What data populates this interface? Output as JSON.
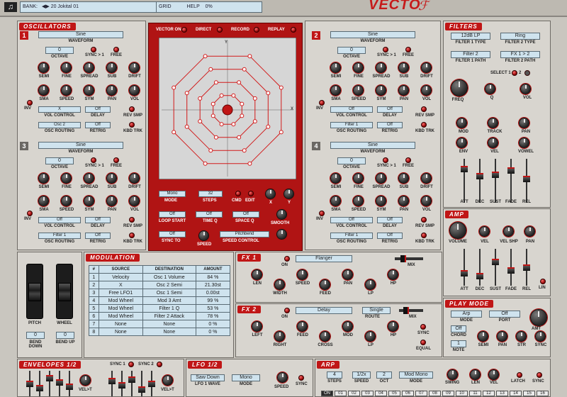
{
  "header": {
    "bank_label": "BANK:",
    "patch": "20 Jokital 01",
    "grid_label": "GRID",
    "help_label": "HELP",
    "percent": "0%",
    "logo": "VECTO"
  },
  "oscillators": {
    "title": "OSCILLATORS",
    "waveform_label": "WAVEFORM",
    "octave_label": "OCTAVE",
    "sync_label": "SYNC > 1",
    "free_label": "FREE",
    "knobs_row1": [
      "SEMI",
      "FINE",
      "SPREAD",
      "SUB",
      "DRIFT"
    ],
    "knobs_row2": [
      "SMA",
      "SPEED",
      "SYM",
      "PAN",
      "VOL"
    ],
    "inv_label": "INV",
    "vol_control_label": "VOL CONTROL",
    "delay_label": "DELAY",
    "rev_smp_label": "REV SMP",
    "osc_routing_label": "OSC ROUTING",
    "retrig_label": "RETRIG",
    "kbd_trk_label": "KBD TRK",
    "units": [
      {
        "num": "1",
        "wave": "Sine",
        "octave": "0",
        "vol_ctrl": "X",
        "delay": "Off",
        "routing": "Osc 2",
        "retrig": "Off"
      },
      {
        "num": "2",
        "wave": "Sine",
        "octave": "0",
        "vol_ctrl": "Off",
        "delay": "Off",
        "routing": "Filter 1",
        "retrig": "Off"
      },
      {
        "num": "3",
        "wave": "Sine",
        "octave": "0",
        "vol_ctrl": "Off",
        "delay": "Off",
        "routing": "Filter 1",
        "retrig": "Off"
      },
      {
        "num": "4",
        "wave": "Sine",
        "octave": "0",
        "vol_ctrl": "Off",
        "delay": "Off",
        "routing": "Filter 1",
        "retrig": "Off"
      }
    ]
  },
  "vector": {
    "vector_on": "VECTOR ON",
    "direct": "DIRECT",
    "record": "RECORD",
    "replay": "REPLAY",
    "axis_x": "X",
    "axis_y": "Y",
    "mode_val": "Mono",
    "mode_label": "MODE",
    "steps_val": "32",
    "steps_label": "STEPS",
    "cmd": "CMD",
    "edit": "EDIT",
    "x_label": "X",
    "y_label": "Y",
    "loop_start_val": "Off",
    "loop_start_label": "LOOP START",
    "time_q_val": "Off",
    "time_q_label": "TIME Q",
    "space_q_val": "Off",
    "space_q_label": "SPACE Q",
    "smooth_label": "SMOOTH",
    "sync_to_val": "Off",
    "sync_to_label": "SYNC TO",
    "speed_label": "SPEED",
    "speed_ctrl_val": "Pitchbend",
    "speed_ctrl_label": "SPEED CONTROL"
  },
  "filters": {
    "title": "FILTERS",
    "f1type": "12dB LP",
    "f1type_label": "FILTER 1 TYPE",
    "f2type": "Ring",
    "f2type_label": "FILTER 2 TYPE",
    "f1path": "Filter 2",
    "f1path_label": "FILTER 1 PATH",
    "f2path": "FX 1 > 2",
    "f2path_label": "FILTER 2 PATH",
    "select_label": "SELECT 1",
    "select_2": "2",
    "knob_labels": [
      "FREQ",
      "Q",
      "VOL",
      "MOD",
      "TRACK",
      "PAN",
      "ENV",
      "VEL",
      "VOWEL"
    ],
    "adsr": [
      "ATT",
      "DEC",
      "SUST",
      "FADE",
      "REL"
    ]
  },
  "amp": {
    "title": "AMP",
    "knob_labels": [
      "VOLUME",
      "VEL",
      "VEL SHP",
      "PAN"
    ],
    "adsr": [
      "ATT",
      "DEC",
      "SUST",
      "FADE",
      "REL"
    ],
    "lin": "LIN"
  },
  "playmode": {
    "title": "PLAY MODE",
    "mode_val": "Arp",
    "mode_label": "MODE",
    "port_val": "Off",
    "port_label": "PORT",
    "amt_label": "AMT",
    "chord_val": "Off",
    "chord_label": "CHORD",
    "note_val": "1",
    "note_label": "NOTE",
    "knobs": [
      "SEMI",
      "PAN",
      "STR",
      "SYNC"
    ]
  },
  "wheels": {
    "pitch": "PITCH",
    "wheel": "WHEEL",
    "bend_down_val": "0",
    "bend_down_label": "BEND DOWN",
    "bend_up_val": "0",
    "bend_up_label": "BEND UP"
  },
  "modulation": {
    "title": "MODULATION",
    "headers": [
      "#",
      "SOURCE",
      "DESTINATION",
      "AMOUNT"
    ],
    "rows": [
      [
        "1",
        "Velocity",
        "Osc 1 Volume",
        "84 %"
      ],
      [
        "2",
        "X",
        "Osc 2 Semi",
        "21.30st"
      ],
      [
        "3",
        "Free LFO1",
        "Osc 1 Semi",
        "0.00st"
      ],
      [
        "4",
        "Mod Wheel",
        "Mod 3 Amt",
        "99 %"
      ],
      [
        "5",
        "Mod Wheel",
        "Filter 1 Q",
        "53 %"
      ],
      [
        "6",
        "Mod Wheel",
        "Filter 2 Attack",
        "78 %"
      ],
      [
        "7",
        "None",
        "None",
        "0 %"
      ],
      [
        "8",
        "None",
        "None",
        "0 %"
      ]
    ]
  },
  "fx1": {
    "title": "FX 1",
    "on": "ON",
    "type": "Flanger",
    "mix": "MIX",
    "knobs": [
      "LEN",
      "WIDTH",
      "SPEED",
      "FEED",
      "PAN",
      "LP",
      "HP"
    ]
  },
  "fx2": {
    "title": "FX 2",
    "on": "ON",
    "type": "Delay",
    "route_val": "Single",
    "route_label": "ROUTE",
    "mix": "MIX",
    "sync": "SYNC",
    "equal": "EQUAL",
    "knobs": [
      "LEFT",
      "RIGHT",
      "FEED",
      "CROSS",
      "MOD",
      "LP",
      "HP"
    ]
  },
  "envelopes": {
    "title": "ENVELOPES 1/2",
    "sync1": "SYNC 1",
    "sync2": "SYNC 2",
    "vel1": "VEL>T",
    "vel2": "VEL>T"
  },
  "lfo": {
    "title": "LFO 1/2",
    "wave_val": "Saw Down",
    "wave_label": "LFO 1 WAVE",
    "mode_val": "Mono",
    "mode_label": "MODE",
    "speed": "SPEED",
    "sync": "SYNC"
  },
  "arp": {
    "title": "ARP",
    "steps_val": "4",
    "steps_label": "STEPS",
    "speed_val": "1/2x",
    "speed_label": "SPEED",
    "oct_val": "2",
    "oct_label": "OCT",
    "mode_val": "Mod Mono",
    "mode_label": "MODE",
    "swing": "SWING",
    "len": "LEN",
    "vel": "VEL",
    "latch": "LATCH",
    "sync": "SYNC",
    "seq": [
      "ON",
      "01",
      "02",
      "03",
      "04",
      "05",
      "06",
      "07",
      "08",
      "09",
      "10",
      "11",
      "12",
      "13",
      "14",
      "15",
      "16"
    ]
  }
}
